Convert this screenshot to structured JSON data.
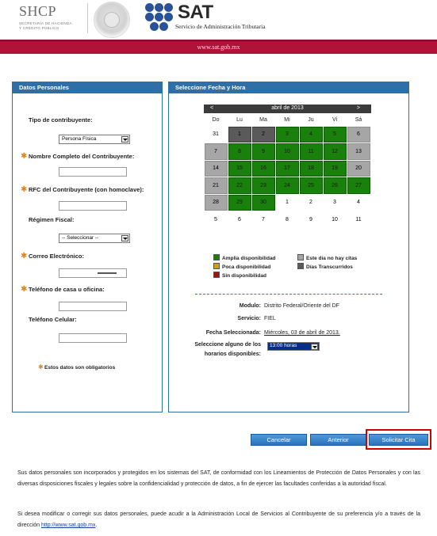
{
  "header": {
    "shcp_title": "SHCP",
    "shcp_sub1": "SECRETARÍA DE HACIENDA",
    "shcp_sub2": "Y CRÉDITO PÚBLICO",
    "sat_title": "SAT",
    "sat_subtitle": "Servicio de Administración Tributaria",
    "site_url": "www.sat.gob.mx"
  },
  "left_panel": {
    "title": "Datos Personales",
    "tipo_label": "Tipo de contribuyente:",
    "tipo_value": "Persona Física",
    "nombre_label": "Nombre Completo del Contribuyente:",
    "nombre_value": "",
    "rfc_label": "RFC del Contribuyente (con homoclave):",
    "rfc_value": "",
    "regimen_label": "Régimen Fiscal:",
    "regimen_value": "-- Seleccionar --",
    "correo_label": "Correo Electrónico:",
    "telefono_label": "Teléfono de casa u oficina:",
    "telefono_value": "",
    "celular_label": "Teléfono Celular:",
    "celular_value": "",
    "required_note": "Estos datos son obligatorios"
  },
  "right_panel": {
    "title": "Seleccione Fecha y Hora",
    "calendar": {
      "prev": "<",
      "next": ">",
      "month_title": "abril de 2013",
      "days_of_week": [
        "Do",
        "Lu",
        "Ma",
        "Mi",
        "Ju",
        "Vi",
        "Sá"
      ],
      "cells": [
        {
          "d": "31",
          "s": "plain"
        },
        {
          "d": "1",
          "s": "dark"
        },
        {
          "d": "2",
          "s": "dark"
        },
        {
          "d": "3",
          "s": "green"
        },
        {
          "d": "4",
          "s": "green"
        },
        {
          "d": "5",
          "s": "green"
        },
        {
          "d": "6",
          "s": "gray"
        },
        {
          "d": "7",
          "s": "gray"
        },
        {
          "d": "8",
          "s": "green"
        },
        {
          "d": "9",
          "s": "green"
        },
        {
          "d": "10",
          "s": "green"
        },
        {
          "d": "11",
          "s": "green"
        },
        {
          "d": "12",
          "s": "green"
        },
        {
          "d": "13",
          "s": "gray"
        },
        {
          "d": "14",
          "s": "gray"
        },
        {
          "d": "15",
          "s": "green"
        },
        {
          "d": "16",
          "s": "green"
        },
        {
          "d": "17",
          "s": "green"
        },
        {
          "d": "18",
          "s": "green"
        },
        {
          "d": "19",
          "s": "green"
        },
        {
          "d": "20",
          "s": "gray"
        },
        {
          "d": "21",
          "s": "gray"
        },
        {
          "d": "22",
          "s": "green"
        },
        {
          "d": "23",
          "s": "green"
        },
        {
          "d": "24",
          "s": "green"
        },
        {
          "d": "25",
          "s": "green"
        },
        {
          "d": "26",
          "s": "green"
        },
        {
          "d": "27",
          "s": "green"
        },
        {
          "d": "28",
          "s": "gray"
        },
        {
          "d": "29",
          "s": "green"
        },
        {
          "d": "30",
          "s": "green"
        },
        {
          "d": "1",
          "s": "plain"
        },
        {
          "d": "2",
          "s": "plain"
        },
        {
          "d": "3",
          "s": "plain"
        },
        {
          "d": "4",
          "s": "plain"
        },
        {
          "d": "5",
          "s": "plain"
        },
        {
          "d": "6",
          "s": "plain"
        },
        {
          "d": "7",
          "s": "plain"
        },
        {
          "d": "8",
          "s": "plain"
        },
        {
          "d": "9",
          "s": "plain"
        },
        {
          "d": "10",
          "s": "plain"
        },
        {
          "d": "11",
          "s": "plain"
        }
      ]
    },
    "legend": {
      "amplia": "Amplia disponibilidad",
      "poca": "Poca disponibilidad",
      "sin": "Sin disponibilidad",
      "no_citas": "Este día no hay citas",
      "transcurridos": "Días Transcurridos"
    },
    "modulo_label": "Modulo:",
    "modulo_value": "Distrito Federal/Oriente del DF",
    "servicio_label": "Servicio:",
    "servicio_value": "FIEL",
    "fecha_label": "Fecha Seleccionada:",
    "fecha_value": "Miércoles, 03 de abril de 2013.",
    "horario_label_1": "Seleccione alguno de los",
    "horario_label_2": "horarios disponibles:",
    "horario_value": "13:00 horas"
  },
  "buttons": {
    "cancelar": "Cancelar",
    "anterior": "Anterior",
    "solicitar": "Solicitar Cita"
  },
  "footer": {
    "paragraph1": "Sus datos personales son incorporados y protegidos en los sistemas del SAT, de conformidad con los Lineamientos de Protección de Datos Personales y con las diversas disposiciones fiscales y legales sobre la confidencialidad y protección de datos, a fin de ejercer las facultades conferidas a la autoridad fiscal.",
    "paragraph2": "Si desea modificar o corregir sus datos personales, puede acudir a la Administración Local de Servicios al Contribuyente de su preferencia y/o a través de la dirección",
    "link": "http://www.sat.gob.mx",
    "link_suffix": "."
  },
  "colors": {
    "brand_red": "#b0123a",
    "panel_blue": "#2f6fa7",
    "available_green": "#19800b",
    "poca_yellow": "#c8a214",
    "sin_red": "#9c1414",
    "no_citas_gray": "#a6a6a6",
    "transcurridos_dark": "#5a5a5a"
  }
}
